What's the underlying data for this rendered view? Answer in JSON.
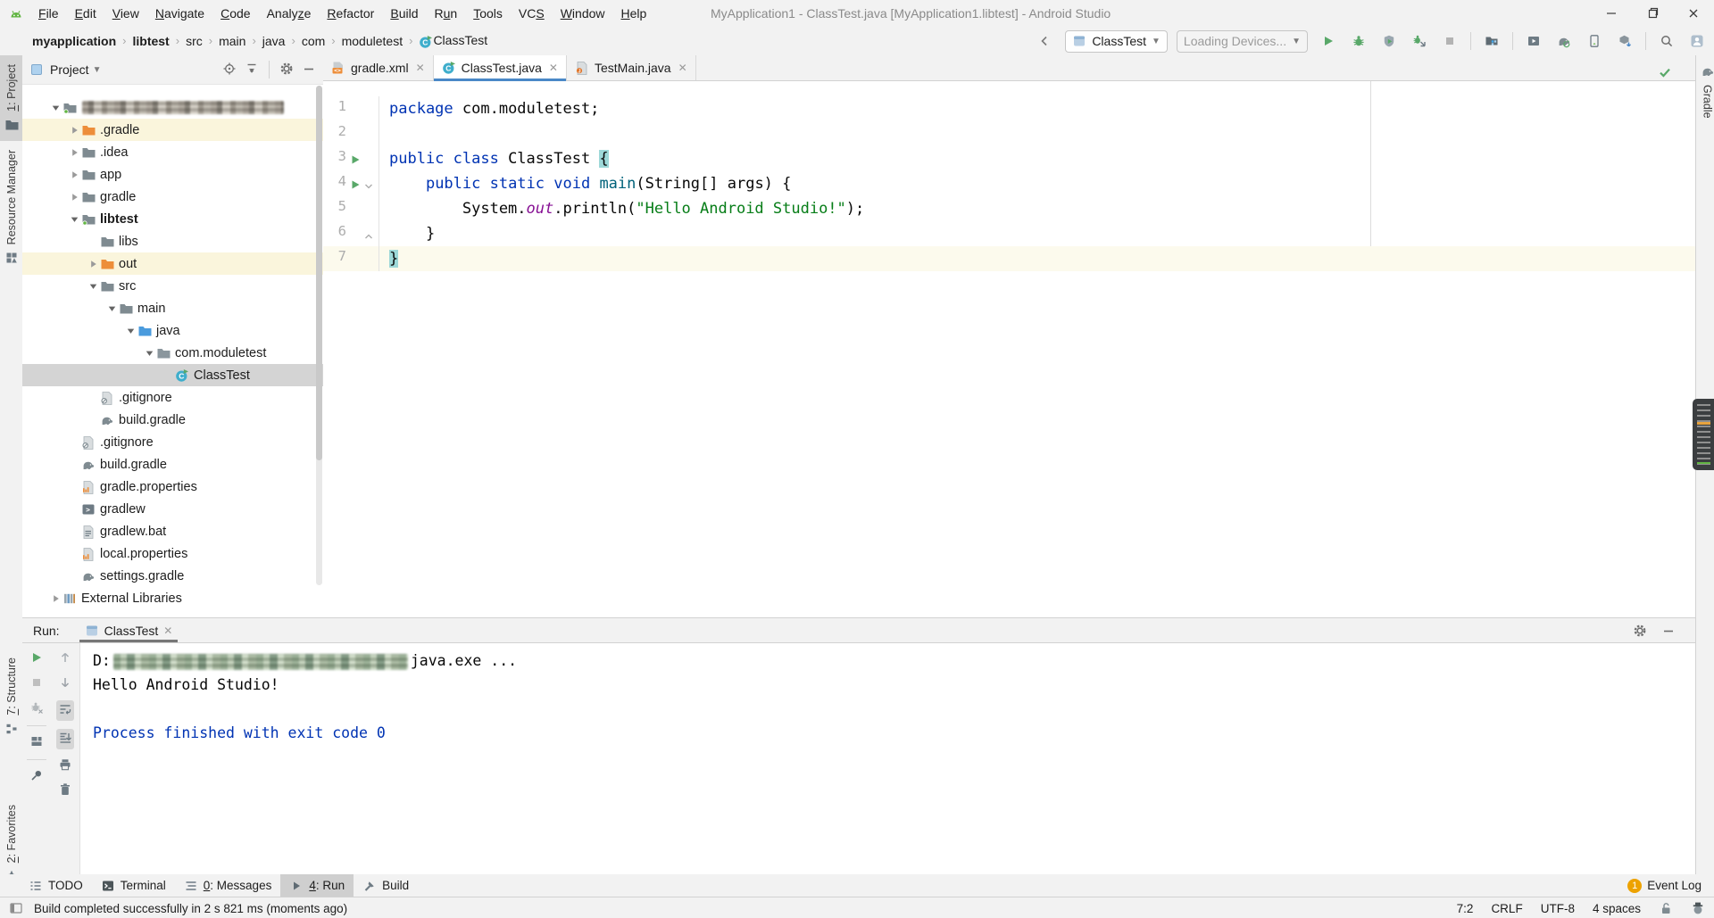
{
  "titlebar": {
    "title": "MyApplication1 - ClassTest.java [MyApplication1.libtest] - Android Studio",
    "menu": [
      {
        "label": "File",
        "m": 0
      },
      {
        "label": "Edit",
        "m": 0
      },
      {
        "label": "View",
        "m": 0
      },
      {
        "label": "Navigate",
        "m": 0
      },
      {
        "label": "Code",
        "m": 0
      },
      {
        "label": "Analyze",
        "m": 5
      },
      {
        "label": "Refactor",
        "m": 0
      },
      {
        "label": "Build",
        "m": 0
      },
      {
        "label": "Run",
        "m": 1
      },
      {
        "label": "Tools",
        "m": 0
      },
      {
        "label": "VCS",
        "m": 2
      },
      {
        "label": "Window",
        "m": 0
      },
      {
        "label": "Help",
        "m": 0
      }
    ]
  },
  "navbar": {
    "breadcrumbs": [
      {
        "label": "myapplication",
        "bold": true
      },
      {
        "label": "libtest",
        "bold": true
      },
      {
        "label": "src"
      },
      {
        "label": "main"
      },
      {
        "label": "java"
      },
      {
        "label": "com"
      },
      {
        "label": "moduletest"
      },
      {
        "label": "ClassTest",
        "icon": "class-run"
      }
    ],
    "run_config": "ClassTest",
    "device_selector": "Loading Devices...",
    "actions": [
      "run",
      "debug",
      "coverage",
      "attach-debugger",
      "stop",
      "|",
      "profiler",
      "|",
      "avd-manager",
      "gradle-sync",
      "device-manager",
      "sdk-manager",
      "|",
      "search",
      "avatar"
    ]
  },
  "left_toolbar": {
    "top": [
      {
        "label": "1: Project",
        "m": 0,
        "icon": "folder-tab",
        "active": true
      },
      {
        "label": "Resource Manager",
        "icon": "resource-manager"
      }
    ],
    "bottom": [
      {
        "label": "7: Structure",
        "m": 0,
        "icon": "structure"
      },
      {
        "label": "2: Favorites",
        "m": 0,
        "icon": "star"
      }
    ]
  },
  "right_toolbar": {
    "top": [
      {
        "label": "Gradle",
        "icon": "gradle-elephant"
      }
    ]
  },
  "project": {
    "header": {
      "title": "Project"
    },
    "tree": [
      {
        "label": "",
        "depth": 0,
        "arrow": "expanded",
        "icon": "folder-module",
        "redacted": true
      },
      {
        "label": ".gradle",
        "depth": 1,
        "arrow": "collapsed",
        "icon": "folder-orange",
        "bg": "excluded"
      },
      {
        "label": ".idea",
        "depth": 1,
        "arrow": "collapsed",
        "icon": "folder"
      },
      {
        "label": "app",
        "depth": 1,
        "arrow": "collapsed",
        "icon": "folder"
      },
      {
        "label": "gradle",
        "depth": 1,
        "arrow": "collapsed",
        "icon": "folder"
      },
      {
        "label": "libtest",
        "depth": 1,
        "arrow": "expanded",
        "icon": "folder-module",
        "bold": true
      },
      {
        "label": "libs",
        "depth": 2,
        "icon": "folder"
      },
      {
        "label": "out",
        "depth": 2,
        "arrow": "collapsed",
        "icon": "folder-orange",
        "bg": "excluded"
      },
      {
        "label": "src",
        "depth": 2,
        "arrow": "expanded",
        "icon": "folder"
      },
      {
        "label": "main",
        "depth": 3,
        "arrow": "expanded",
        "icon": "folder"
      },
      {
        "label": "java",
        "depth": 4,
        "arrow": "expanded",
        "icon": "folder-source"
      },
      {
        "label": "com.moduletest",
        "depth": 5,
        "arrow": "expanded",
        "icon": "folder-package"
      },
      {
        "label": "ClassTest",
        "depth": 6,
        "icon": "class-run",
        "bg": "selected"
      },
      {
        "label": ".gitignore",
        "depth": 2,
        "icon": "gitignore"
      },
      {
        "label": "build.gradle",
        "depth": 2,
        "icon": "gradle-file"
      },
      {
        "label": ".gitignore",
        "depth": 1,
        "icon": "gitignore"
      },
      {
        "label": "build.gradle",
        "depth": 1,
        "icon": "gradle-file"
      },
      {
        "label": "gradle.properties",
        "depth": 1,
        "icon": "properties"
      },
      {
        "label": "gradlew",
        "depth": 1,
        "icon": "console-file"
      },
      {
        "label": "gradlew.bat",
        "depth": 1,
        "icon": "bat-file"
      },
      {
        "label": "local.properties",
        "depth": 1,
        "icon": "properties"
      },
      {
        "label": "settings.gradle",
        "depth": 1,
        "icon": "gradle-file"
      },
      {
        "label": "External Libraries",
        "depth": 0,
        "arrow": "collapsed",
        "icon": "libraries"
      }
    ]
  },
  "editor": {
    "tabs": [
      {
        "label": "gradle.xml",
        "icon": "xml-file",
        "closable": true
      },
      {
        "label": "ClassTest.java",
        "icon": "class-run",
        "active": true,
        "closable": true
      },
      {
        "label": "TestMain.java",
        "icon": "java-file",
        "closable": true
      }
    ],
    "lines": [
      {
        "num": "1",
        "tokens": [
          {
            "t": "package",
            "c": "kw"
          },
          {
            "t": " com.moduletest;",
            "c": "pl"
          }
        ]
      },
      {
        "num": "2",
        "tokens": []
      },
      {
        "num": "3",
        "run": true,
        "tokens": [
          {
            "t": "public class",
            "c": "kw"
          },
          {
            "t": " ClassTest ",
            "c": "pl"
          },
          {
            "t": "{",
            "c": "br"
          }
        ]
      },
      {
        "num": "4",
        "run": true,
        "fold": "v",
        "tokens": [
          {
            "t": "    ",
            "c": "pl"
          },
          {
            "t": "public static void",
            "c": "kw"
          },
          {
            "t": " ",
            "c": "pl"
          },
          {
            "t": "main",
            "c": "mt"
          },
          {
            "t": "(String[] args) {",
            "c": "pl"
          }
        ]
      },
      {
        "num": "5",
        "tokens": [
          {
            "t": "        System.",
            "c": "pl"
          },
          {
            "t": "out",
            "c": "fd"
          },
          {
            "t": ".println(",
            "c": "pl"
          },
          {
            "t": "\"Hello Android Studio!\"",
            "c": "st"
          },
          {
            "t": ");",
            "c": "pl"
          }
        ]
      },
      {
        "num": "6",
        "fold": "^",
        "tokens": [
          {
            "t": "    }",
            "c": "pl"
          }
        ]
      },
      {
        "num": "7",
        "current": true,
        "tokens": [
          {
            "t": "}",
            "c": "br"
          }
        ]
      }
    ]
  },
  "run": {
    "label": "Run:",
    "tab": {
      "title": "ClassTest",
      "icon": "run-config"
    },
    "toolbar_main": [
      "rerun",
      "stop-disabled",
      "bug-disabled",
      "|",
      "layout",
      "|",
      "pin"
    ],
    "toolbar_console": [
      {
        "icon": "up"
      },
      {
        "icon": "down"
      },
      {
        "icon": "soft-wrap",
        "on": true
      },
      {
        "icon": "scroll-end",
        "on": true
      },
      {
        "icon": "print"
      },
      {
        "icon": "clear"
      }
    ],
    "console": [
      {
        "kind": "command",
        "prefix": "D:",
        "redacted": true,
        "suffix": "java.exe ..."
      },
      {
        "kind": "stdout",
        "text": "Hello Android Studio!"
      },
      {
        "kind": "stdout",
        "text": ""
      },
      {
        "kind": "system",
        "text": "Process finished with exit code 0"
      }
    ]
  },
  "bottom_toolbar": {
    "items": [
      {
        "label": "TODO",
        "icon": "todo"
      },
      {
        "label": "Terminal",
        "icon": "terminal"
      },
      {
        "label": "0: Messages",
        "m": 0,
        "icon": "messages"
      },
      {
        "label": "4: Run",
        "m": 0,
        "icon": "run-tab",
        "active": true
      },
      {
        "label": "Build",
        "icon": "build"
      }
    ],
    "event_log": {
      "badge": "1",
      "label": "Event Log"
    }
  },
  "statusbar": {
    "message": "Build completed successfully in 2 s 821 ms (moments ago)",
    "caret": "7:2",
    "line_sep": "CRLF",
    "encoding": "UTF-8",
    "indent": "4 spaces"
  }
}
